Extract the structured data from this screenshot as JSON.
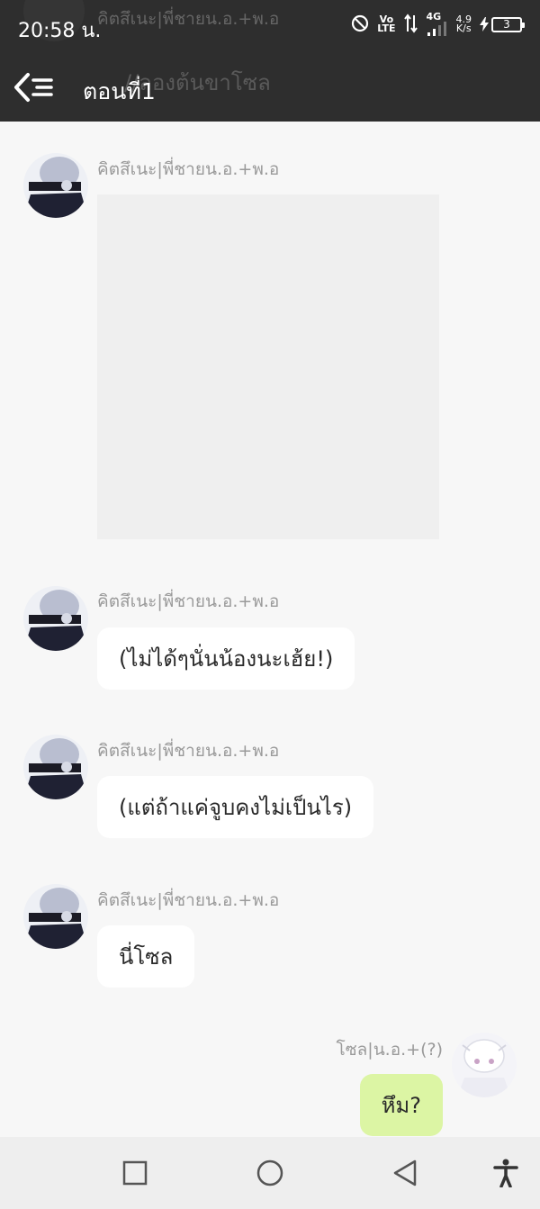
{
  "status_bar": {
    "time": "20:58 น.",
    "volte_top": "Vo",
    "volte_bottom": "LTE",
    "network": "4G",
    "speed_value": "4.9",
    "speed_unit": "K/s",
    "battery": "3"
  },
  "header": {
    "title": "ตอนที่1",
    "behind_sender": "คิตสึเนะ|พี่ชายน.อ.+พ.อ",
    "behind_message": "//ลองต้นขาโซล"
  },
  "messages": [
    {
      "sender": "คิตสึเนะ|พี่ชายน.อ.+พ.อ",
      "type": "image"
    },
    {
      "sender": "คิตสึเนะ|พี่ชายน.อ.+พ.อ",
      "text": "(ไม่ได้ๆนั่นน้องนะเฮ้ย!)"
    },
    {
      "sender": "คิตสึเนะ|พี่ชายน.อ.+พ.อ",
      "text": "(แต่ถ้าแค่จูบคงไม่เป็นไร)"
    },
    {
      "sender": "คิตสึเนะ|พี่ชายน.อ.+พ.อ",
      "text": "นี่โซล"
    },
    {
      "sender": "โซล|น.อ.+(?)",
      "text": "หึม?"
    }
  ],
  "colors": {
    "header_bg": "#2e2e2e",
    "chat_bg": "#f7f7f7",
    "bubble_in": "#ffffff",
    "bubble_out": "#dcf5a4",
    "navbar_bg": "#eeeeee"
  },
  "icons": {
    "back": "back-list-icon",
    "dnd": "do-not-disturb-icon",
    "data": "data-arrows-icon",
    "signal": "signal-icon",
    "charging": "charging-bolt-icon",
    "nav_recent": "square-icon",
    "nav_home": "circle-icon",
    "nav_back": "triangle-back-icon",
    "accessibility": "accessibility-icon"
  }
}
